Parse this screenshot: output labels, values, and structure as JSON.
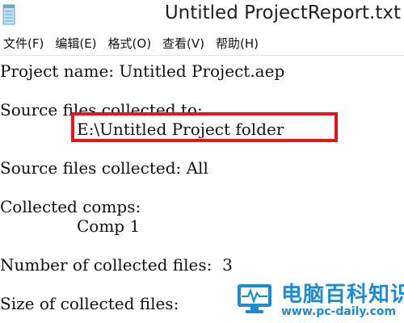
{
  "window": {
    "title": "Untitled ProjectReport.txt",
    "icon": "notepad-icon"
  },
  "menubar": {
    "items": [
      {
        "label": "文件(F)"
      },
      {
        "label": "编辑(E)"
      },
      {
        "label": "格式(O)"
      },
      {
        "label": "查看(V)"
      },
      {
        "label": "帮助(H)"
      }
    ]
  },
  "document": {
    "lines": [
      "Project name: Untitled Project.aep",
      "Source files collected to:",
      "E:\\Untitled Project folder",
      "Source files collected: All",
      "Collected comps:",
      "Comp 1",
      "Number of collected files:  3",
      "Size of collected files:"
    ]
  },
  "watermark": {
    "title": "电脑百科知识",
    "url": "www.pc-daily.com"
  },
  "colors": {
    "highlight": "#e8141c",
    "watermark": "#1d8ad6"
  }
}
